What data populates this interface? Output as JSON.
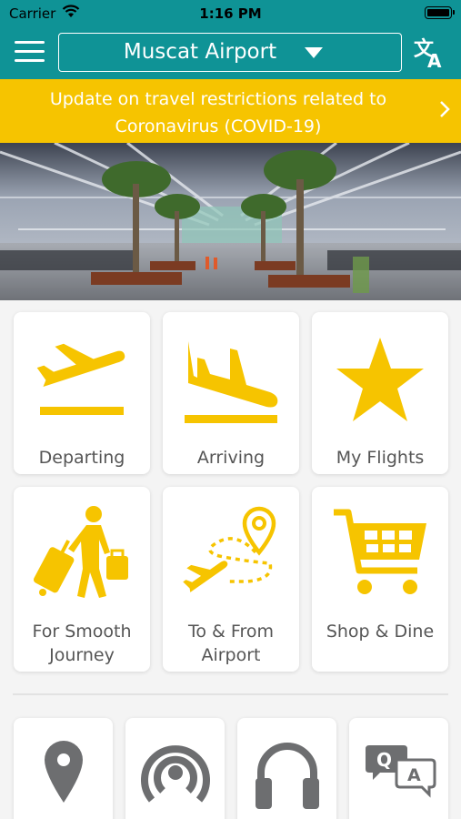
{
  "status_bar": {
    "carrier": "Carrier",
    "time": "1:16 PM"
  },
  "header": {
    "airport": "Muscat Airport"
  },
  "banner": {
    "line1": "Update on travel restrictions related to",
    "line2": "Coronavirus (COVID-19)"
  },
  "tiles": [
    {
      "icon": "departing-plane-icon",
      "label": "Departing"
    },
    {
      "icon": "arriving-plane-icon",
      "label": "Arriving"
    },
    {
      "icon": "star-icon",
      "label": "My Flights"
    },
    {
      "icon": "traveler-luggage-icon",
      "line1": "For Smooth",
      "line2": "Journey"
    },
    {
      "icon": "route-plane-icon",
      "line1": "To & From",
      "line2": "Airport"
    },
    {
      "icon": "shopping-cart-icon",
      "label": "Shop & Dine"
    }
  ],
  "bottom_tiles": [
    {
      "icon": "map-pin-icon"
    },
    {
      "icon": "wifi-signal-icon"
    },
    {
      "icon": "headphones-icon"
    },
    {
      "icon": "faq-chat-icon"
    }
  ],
  "colors": {
    "teal": "#0f9396",
    "yellow": "#f6c400",
    "grey_icon": "#6d6e70"
  }
}
